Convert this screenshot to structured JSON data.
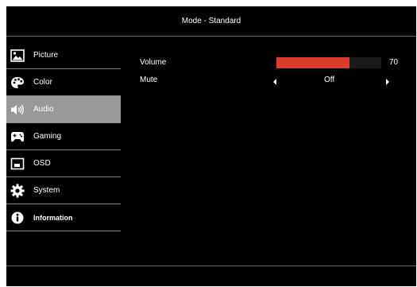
{
  "header": {
    "title": "Mode - Standard"
  },
  "sidebar": {
    "items": [
      {
        "label": "Picture",
        "icon": "picture-icon",
        "selected": false
      },
      {
        "label": "Color",
        "icon": "palette-icon",
        "selected": false
      },
      {
        "label": "Audio",
        "icon": "speaker-icon",
        "selected": true
      },
      {
        "label": "Gaming",
        "icon": "gamepad-icon",
        "selected": false
      },
      {
        "label": "OSD",
        "icon": "osd-icon",
        "selected": false
      },
      {
        "label": "System",
        "icon": "gear-icon",
        "selected": false
      },
      {
        "label": "Information",
        "icon": "info-icon",
        "selected": false
      }
    ]
  },
  "audio": {
    "volume": {
      "label": "Volume",
      "value": "70",
      "level_percent": 70
    },
    "mute": {
      "label": "Mute",
      "value": "Off"
    }
  },
  "colors": {
    "background": "#000000",
    "selected_item": "#999999",
    "volume_bar": "#dd3b2a",
    "text": "#ffffff"
  }
}
